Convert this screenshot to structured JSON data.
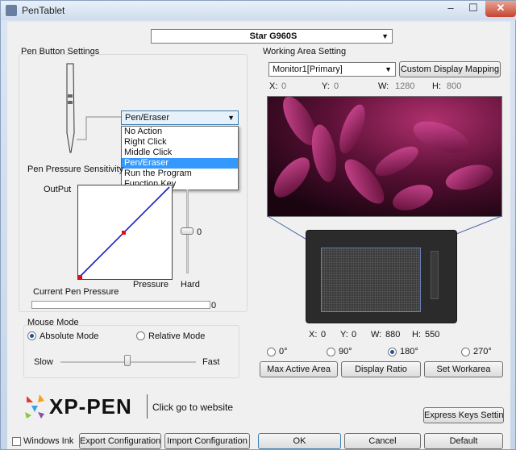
{
  "window": {
    "title": "PenTablet",
    "min": "–",
    "max": "☐",
    "close": "✕"
  },
  "device": {
    "selected": "Star G960S"
  },
  "pen_buttons": {
    "group_label": "Pen Button Settings",
    "selected": "Pen/Eraser",
    "options": [
      "No Action",
      "Right Click",
      "Middle Click",
      "Pen/Eraser",
      "Run the Program",
      "Function Key"
    ],
    "highlighted_index": 3
  },
  "pressure": {
    "label": "Pen Pressure Sensitivity",
    "output_label": "OutPut",
    "pressure_label": "Pressure",
    "hard_label": "Hard",
    "slider_value": "0",
    "current_label": "Current Pen Pressure",
    "current_value": "0",
    "line_color": "#1a1ad6",
    "point_color": "#e01010"
  },
  "mouse_mode": {
    "label": "Mouse Mode",
    "absolute": "Absolute Mode",
    "relative": "Relative Mode",
    "selected": "absolute",
    "slow": "Slow",
    "fast": "Fast",
    "speed": 0.5
  },
  "working_area": {
    "label": "Working Area Setting",
    "monitor": "Monitor1[Primary]",
    "custom_mapping": "Custom Display Mapping",
    "screen": {
      "x_label": "X:",
      "x": "0",
      "y_label": "Y:",
      "y": "0",
      "w_label": "W:",
      "w": "1280",
      "h_label": "H:",
      "h": "800"
    },
    "tablet": {
      "x_label": "X:",
      "x": "0",
      "y_label": "Y:",
      "y": "0",
      "w_label": "W:",
      "w": "880",
      "h_label": "H:",
      "h": "550"
    },
    "rotations": [
      "0°",
      "90°",
      "180°",
      "270°"
    ],
    "rotation_selected_index": 2,
    "buttons": {
      "max_active": "Max Active Area",
      "display_ratio": "Display Ratio",
      "set_workarea": "Set Workarea"
    }
  },
  "branding": {
    "logo_text": "XP-PEN",
    "website": "Click go to website"
  },
  "bottom": {
    "express_keys": "Express Keys Setting",
    "windows_ink": "Windows Ink",
    "export": "Export Configuration",
    "import": "Import Configuration",
    "ok": "OK",
    "cancel": "Cancel",
    "default": "Default"
  },
  "icons": {
    "combo_arrow": "chevron-down-icon",
    "slider_thumb": "slider-thumb-icon"
  }
}
